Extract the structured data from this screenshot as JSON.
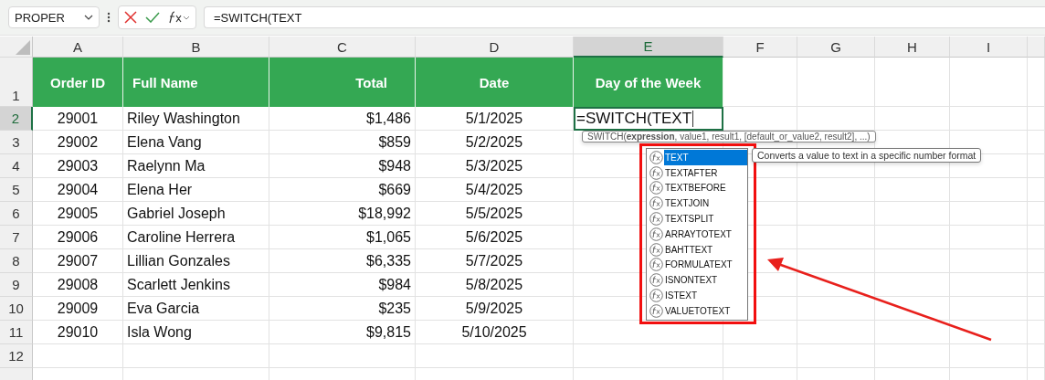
{
  "name_box": "PROPER",
  "formula": "=SWITCH(TEXT",
  "columns": [
    {
      "label": "A",
      "selected": false
    },
    {
      "label": "B",
      "selected": false
    },
    {
      "label": "C",
      "selected": false
    },
    {
      "label": "D",
      "selected": false
    },
    {
      "label": "E",
      "selected": true
    },
    {
      "label": "F",
      "selected": false
    },
    {
      "label": "G",
      "selected": false
    },
    {
      "label": "H",
      "selected": false
    },
    {
      "label": "I",
      "selected": false
    }
  ],
  "header_row": {
    "number": "1",
    "selected": false,
    "cells": [
      "Order ID",
      "Full Name",
      "Total",
      "Date",
      "Day of the Week"
    ]
  },
  "rows": [
    {
      "number": "2",
      "selected": true,
      "cells": [
        "29001",
        "Riley Washington",
        "$1,486",
        "5/1/2025"
      ]
    },
    {
      "number": "3",
      "selected": false,
      "cells": [
        "29002",
        "Elena Vang",
        "$859",
        "5/2/2025"
      ]
    },
    {
      "number": "4",
      "selected": false,
      "cells": [
        "29003",
        "Raelynn Ma",
        "$948",
        "5/3/2025"
      ]
    },
    {
      "number": "5",
      "selected": false,
      "cells": [
        "29004",
        "Elena Her",
        "$669",
        "5/4/2025"
      ]
    },
    {
      "number": "6",
      "selected": false,
      "cells": [
        "29005",
        "Gabriel Joseph",
        "$18,992",
        "5/5/2025"
      ]
    },
    {
      "number": "7",
      "selected": false,
      "cells": [
        "29006",
        "Caroline Herrera",
        "$1,065",
        "5/6/2025"
      ]
    },
    {
      "number": "8",
      "selected": false,
      "cells": [
        "29007",
        "Lillian Gonzales",
        "$6,335",
        "5/7/2025"
      ]
    },
    {
      "number": "9",
      "selected": false,
      "cells": [
        "29008",
        "Scarlett Jenkins",
        "$984",
        "5/8/2025"
      ]
    },
    {
      "number": "10",
      "selected": false,
      "cells": [
        "29009",
        "Eva Garcia",
        "$235",
        "5/9/2025"
      ]
    },
    {
      "number": "11",
      "selected": false,
      "cells": [
        "29010",
        "Isla Wong",
        "$9,815",
        "5/10/2025"
      ]
    },
    {
      "number": "12",
      "selected": false,
      "cells": []
    }
  ],
  "active_cell": {
    "value": "=SWITCH(TEXT"
  },
  "syntax_tooltip": "SWITCH(**expression**, value1, result1, [default_or_value2, result2], ...)",
  "autocomplete": [
    {
      "label": "TEXT",
      "selected": true
    },
    {
      "label": "TEXTAFTER",
      "selected": false
    },
    {
      "label": "TEXTBEFORE",
      "selected": false
    },
    {
      "label": "TEXTJOIN",
      "selected": false
    },
    {
      "label": "TEXTSPLIT",
      "selected": false
    },
    {
      "label": "ARRAYTOTEXT",
      "selected": false
    },
    {
      "label": "BAHTTEXT",
      "selected": false
    },
    {
      "label": "FORMULATEXT",
      "selected": false
    },
    {
      "label": "ISNONTEXT",
      "selected": false
    },
    {
      "label": "ISTEXT",
      "selected": false
    },
    {
      "label": "VALUETOTEXT",
      "selected": false
    }
  ],
  "description": "Converts a value to text in a specific number format"
}
